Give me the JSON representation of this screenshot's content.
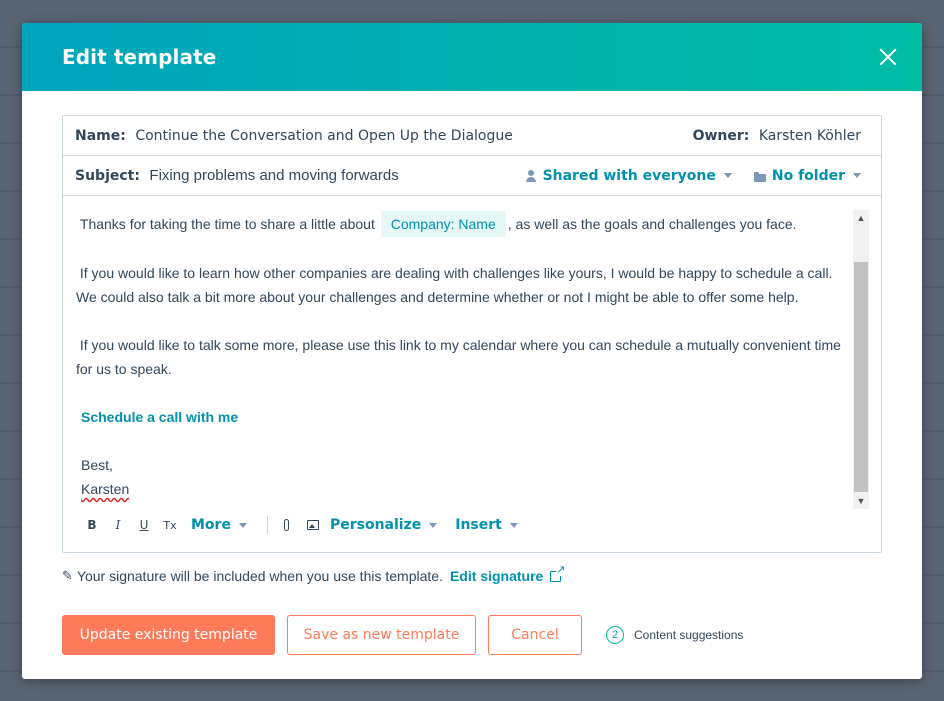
{
  "modal": {
    "title": "Edit template",
    "close_icon": "close-icon"
  },
  "meta": {
    "name_label": "Name:",
    "name_value": "Continue the Conversation and Open Up the Dialogue",
    "owner_label": "Owner:",
    "owner_value": "Karsten Köhler",
    "subject_label": "Subject:",
    "subject_value": "Fixing problems and moving forwards",
    "sharing": "Shared with everyone",
    "folder": "No folder"
  },
  "body": {
    "p1_before": "Thanks for taking the time to share a little about",
    "token": "Company: Name",
    "p1_after": ", as well as the goals and challenges you face.",
    "p2": "If you would like to learn how other companies are dealing with challenges like yours, I would be happy to schedule a call. We could also talk a bit more about your challenges and determine whether or not I might be able to offer some help.",
    "p3": "If you would like to talk some more, please use this link to my calendar where you can schedule a mutually convenient time for us to speak.",
    "link": "Schedule a call with me",
    "closing": "Best,",
    "signature": "Karsten"
  },
  "toolbar": {
    "bold": "B",
    "italic": "I",
    "underline": "U",
    "clear": "Tx",
    "more": "More",
    "personalize": "Personalize",
    "insert": "Insert"
  },
  "signature_note": {
    "text": "Your signature will be included when you use this template.",
    "edit_link": "Edit signature"
  },
  "footer": {
    "update": "Update existing template",
    "save_new": "Save as new template",
    "cancel": "Cancel",
    "suggestions_count": "2",
    "suggestions_label": "Content suggestions"
  },
  "colors": {
    "accent": "#0091ae",
    "primary_button": "#ff7a59",
    "header_start": "#00a4bd",
    "header_end": "#00bda5"
  }
}
